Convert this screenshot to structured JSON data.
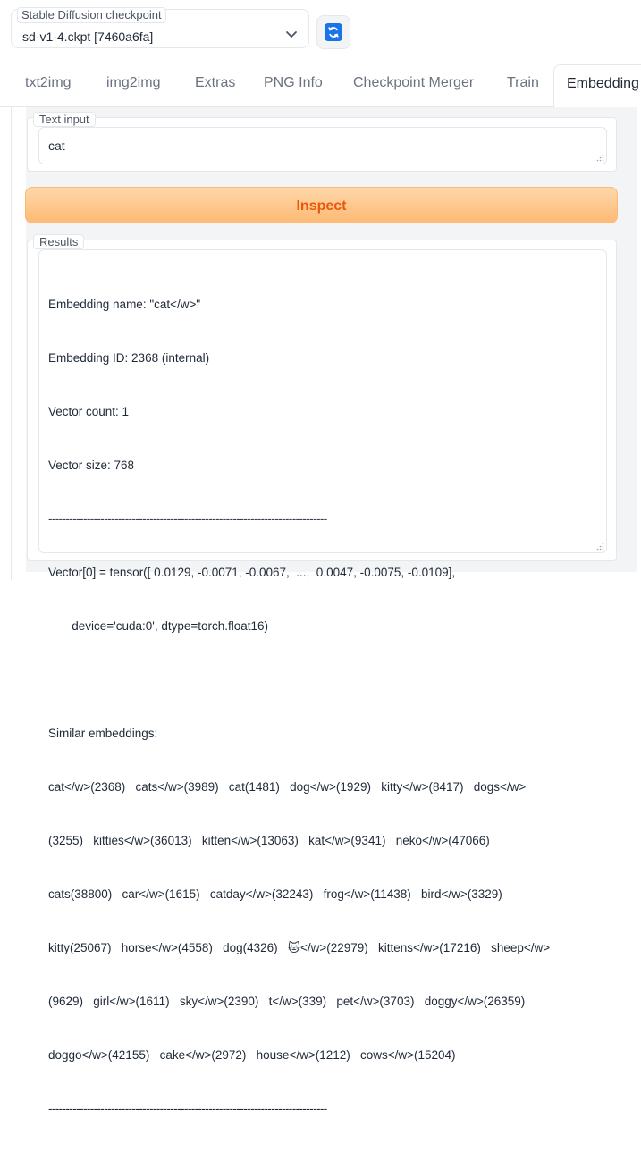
{
  "checkpoint": {
    "label": "Stable Diffusion checkpoint",
    "selected": "sd-v1-4.ckpt [7460a6fa]",
    "refresh_icon": "refresh-icon"
  },
  "tabs": [
    {
      "label": "txt2img"
    },
    {
      "label": "img2img"
    },
    {
      "label": "Extras"
    },
    {
      "label": "PNG Info"
    },
    {
      "label": "Checkpoint Merger"
    },
    {
      "label": "Train"
    },
    {
      "label": "Embedding"
    }
  ],
  "text_input": {
    "label": "Text input",
    "value": "cat"
  },
  "inspect_button": "Inspect",
  "results": {
    "label": "Results",
    "lines": [
      "Embedding name: \"cat</w>\"",
      "Embedding ID: 2368 (internal)",
      "Vector count: 1",
      "Vector size: 768",
      "--------------------------------------------------------------------------------",
      "Vector[0] = tensor([ 0.0129, -0.0071, -0.0067,  ...,  0.0047, -0.0075, -0.0109],",
      "       device='cuda:0', dtype=torch.float16)",
      "",
      "Similar embeddings:",
      "cat</w>(2368)   cats</w>(3989)   cat(1481)   dog</w>(1929)   kitty</w>(8417)   dogs</w>",
      "(3255)   kitties</w>(36013)   kitten</w>(13063)   kat</w>(9341)   neko</w>(47066)",
      "cats(38800)   car</w>(1615)   catday</w>(32243)   frog</w>(11438)   bird</w>(3329)",
      "kitty(25067)   horse</w>(4558)   dog(4326)   🐱</w>(22979)   kittens</w>(17216)   sheep</w>",
      "(9629)   girl</w>(1611)   sky</w>(2390)   t</w>(339)   pet</w>(3703)   doggy</w>(26359)",
      "doggo</w>(42155)   cake</w>(2972)   house</w>(1212)   cows</w>(15204)",
      "--------------------------------------------------------------------------------"
    ]
  }
}
